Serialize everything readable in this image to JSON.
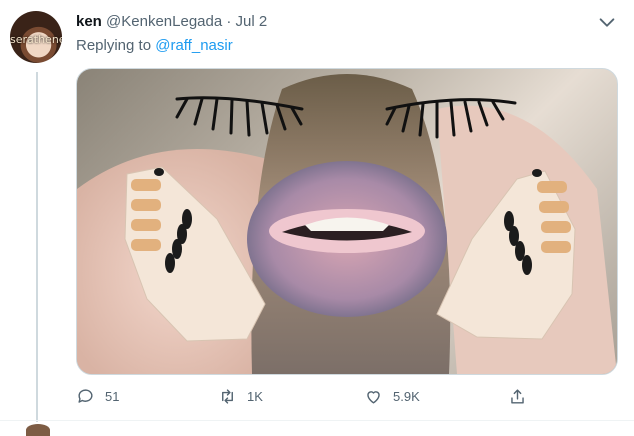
{
  "tweet": {
    "display_name": "ken",
    "handle": "@KenkenLegada",
    "separator": "·",
    "date": "Jul 2",
    "reply_prefix": "Replying to",
    "reply_to": "@raff_nasir",
    "avatar_watermark": "serathenews"
  },
  "actions": {
    "replies": "51",
    "retweets": "1K",
    "likes": "5.9K"
  },
  "icons": [
    "chevron-down-icon",
    "reply-icon",
    "retweet-icon",
    "like-icon",
    "share-icon"
  ],
  "colors": {
    "link": "#1d9bf0",
    "muted": "#536471",
    "text": "#0f1419"
  }
}
